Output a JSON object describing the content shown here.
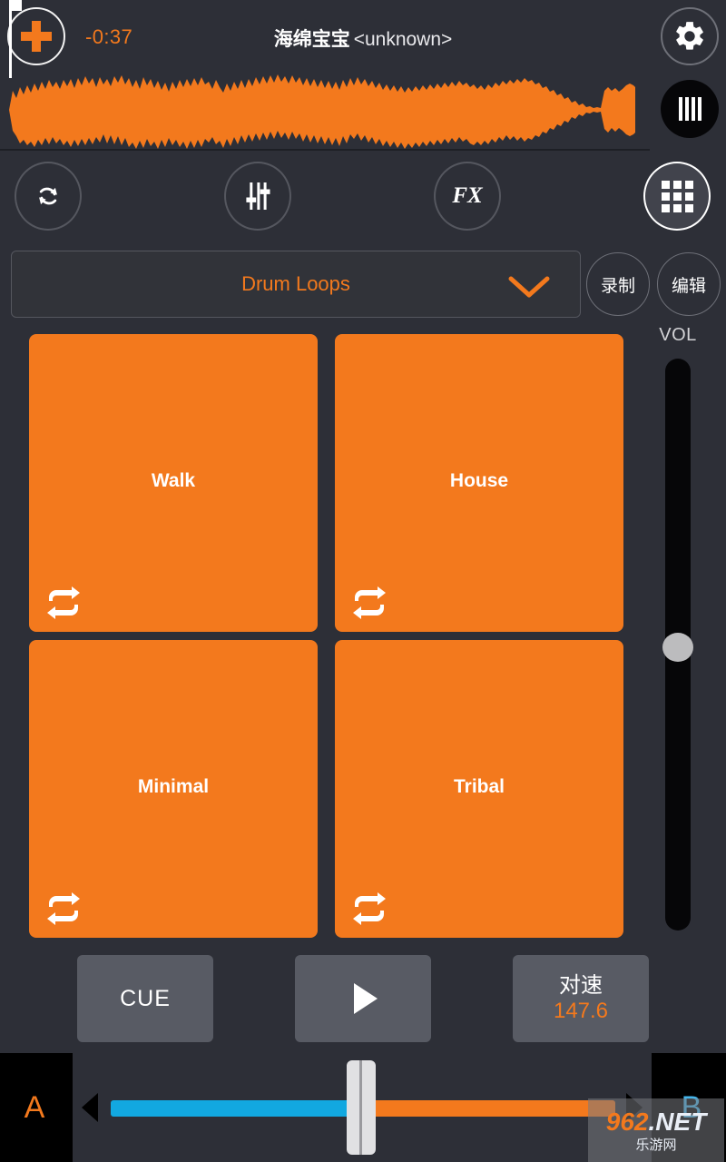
{
  "header": {
    "add_button": "+",
    "time_remaining": "-0:37",
    "track_title": "海绵宝宝",
    "track_artist": "<unknown>",
    "gear_icon": "gear-icon",
    "eq_icon": "equalizer-icon"
  },
  "waveform": {
    "color": "#f3791d",
    "playhead_position_pct": 1.5
  },
  "toolbar": {
    "items": [
      {
        "id": "loop",
        "label": "",
        "icon": "loop-sync-icon",
        "active": false
      },
      {
        "id": "eq",
        "label": "",
        "icon": "faders-icon",
        "active": false
      },
      {
        "id": "fx",
        "label": "FX",
        "icon": "fx-text",
        "active": false
      },
      {
        "id": "sampler",
        "label": "",
        "icon": "grid-pads-icon",
        "active": true
      }
    ]
  },
  "selector": {
    "label": "Drum Loops",
    "chevron_icon": "chevron-down-icon",
    "record_button": "录制",
    "edit_button": "编辑"
  },
  "volume": {
    "label": "VOL",
    "value_pct": 52
  },
  "pads": [
    {
      "label": "Walk",
      "loop_icon": "repeat-icon",
      "color": "#f3791d"
    },
    {
      "label": "House",
      "loop_icon": "repeat-icon",
      "color": "#f3791d"
    },
    {
      "label": "Minimal",
      "loop_icon": "repeat-icon",
      "color": "#f3791d"
    },
    {
      "label": "Tribal",
      "loop_icon": "repeat-icon",
      "color": "#f3791d"
    }
  ],
  "transport": {
    "cue_label": "CUE",
    "play_icon": "play-icon",
    "sync_label": "对速",
    "bpm_value": "147.6"
  },
  "crossfader": {
    "deck_a": "A",
    "deck_b": "B",
    "left_color": "#12a8e0",
    "right_color": "#f3791d",
    "position_pct": 50,
    "arrow_left_icon": "triangle-left-icon",
    "arrow_right_icon": "triangle-right-icon"
  },
  "watermark": {
    "number": "962",
    "suffix": ".NET",
    "subtitle": "乐游网"
  },
  "colors": {
    "accent_orange": "#f3791d",
    "accent_blue": "#12a8e0",
    "background": "#2d2f37",
    "panel": "#585b64"
  }
}
